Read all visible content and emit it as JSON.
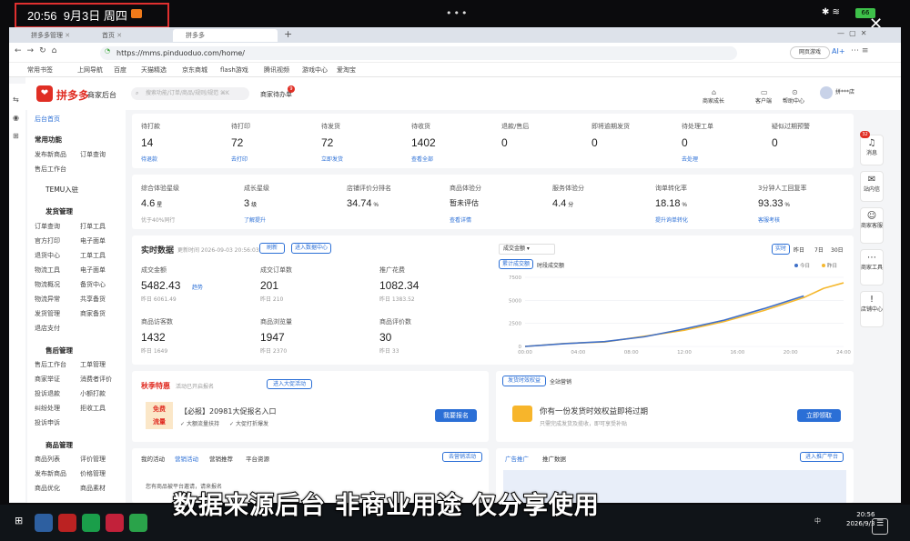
{
  "status": {
    "time": "20:56",
    "date": "9月3日 周四",
    "battery": "66"
  },
  "tabs": [
    {
      "label": "拼多多管理"
    },
    {
      "label": "首页"
    },
    {
      "label": "拼多多"
    }
  ],
  "address": {
    "url": "https://mms.pinduoduo.com/home/",
    "right1": "网页游戏",
    "right2": "AI+"
  },
  "bookmarks": [
    "常用书签",
    "上网导航",
    "百度",
    "天猫精选",
    "京东商城",
    "flash游戏",
    "腾讯视频",
    "游戏中心",
    "爱淘宝"
  ],
  "header": {
    "brand": "拼多多",
    "brand_sub": "商家后台",
    "search_placeholder": "搜索功能/订单/商品/规则/规范 ⌘K",
    "msg": "商家待办单",
    "msg_badge": "9",
    "tools": [
      "商家成长",
      "客户端",
      "帮助中心"
    ],
    "user": "拼***店"
  },
  "nav": {
    "home": "后台首页",
    "sections": [
      {
        "title": "常用功能",
        "items": [
          "发布新商品",
          "订单查询",
          "售后工作台"
        ]
      },
      {
        "title": "TEMU入驻",
        "items": []
      },
      {
        "title": "发货管理",
        "items": [
          "订单查询",
          "打单工具",
          "官方打印",
          "电子面单",
          "退货中心",
          "工单工具",
          "物流工具",
          "电子面单",
          "物流概况",
          "备货中心",
          "物流异常",
          "共享备货",
          "发货管理",
          "商家备货",
          "退店支付"
        ]
      },
      {
        "title": "售后管理",
        "items": [
          "售后工作台",
          "工单管理",
          "商家举证",
          "消费者评价",
          "投诉退款",
          "小额打款",
          "纠纷处理",
          "拒收工具",
          "投诉申诉"
        ]
      },
      {
        "title": "商品管理",
        "items": [
          "商品列表",
          "评价管理",
          "发布新商品",
          "价格管理",
          "商品优化",
          "商品素材"
        ]
      }
    ]
  },
  "todo": [
    {
      "label": "待打款",
      "value": "14",
      "link": "待退款"
    },
    {
      "label": "待打印",
      "value": "72",
      "link": "去打印"
    },
    {
      "label": "待发货",
      "value": "72",
      "link": "立即发货"
    },
    {
      "label": "待收货",
      "value": "1402",
      "link": "查看全部"
    },
    {
      "label": "退款/售后",
      "value": "0",
      "link": ""
    },
    {
      "label": "即将逾期发货",
      "value": "0",
      "link": ""
    },
    {
      "label": "待处理工单",
      "value": "0",
      "link": "去处理"
    },
    {
      "label": "疑似过期预警",
      "value": "0",
      "link": ""
    }
  ],
  "health": [
    {
      "label": "综合体验星级",
      "value": "4.6",
      "unit": "星",
      "sub": "优于40%同行"
    },
    {
      "label": "成长星级",
      "value": "3",
      "unit": "级",
      "sub": "了解提升"
    },
    {
      "label": "店铺评价分排名",
      "value": "34.74",
      "unit": "%",
      "sub": ""
    },
    {
      "label": "商品体验分",
      "value": "暂未评估",
      "unit": "",
      "sub": "查看详情"
    },
    {
      "label": "服务体验分",
      "value": "4.4",
      "unit": "分",
      "sub": ""
    },
    {
      "label": "询单转化率",
      "value": "18.18",
      "unit": "%",
      "sub": "提升询单转化"
    },
    {
      "label": "3分钟人工回复率",
      "value": "93.33",
      "unit": "%",
      "sub": "客服考核"
    }
  ],
  "realtime": {
    "title": "实时数据",
    "updated": "更新时间 2026-09-03 20:56:03",
    "btn_refresh": "刷新",
    "btn_enter": "进入数据中心",
    "metrics": [
      {
        "label": "成交金额",
        "value": "5482.43",
        "sub": "昨日 6061.49",
        "link": "趋势"
      },
      {
        "label": "成交订单数",
        "value": "201",
        "sub": "昨日 210"
      },
      {
        "label": "推广花费",
        "value": "1082.34",
        "sub": "昨日 1383.52"
      },
      {
        "label": "商品访客数",
        "value": "1432",
        "sub": "昨日 1649"
      },
      {
        "label": "商品浏览量",
        "value": "1947",
        "sub": "昨日 2370"
      },
      {
        "label": "商品评价数",
        "value": "30",
        "sub": "昨日 33"
      }
    ]
  },
  "chart_data": {
    "type": "line",
    "title": "",
    "selector": "成交金额",
    "view_tabs": [
      "实时",
      "昨日",
      "7日",
      "30日"
    ],
    "sub_tabs": [
      "累计成交额",
      "时段成交额"
    ],
    "x": [
      "00:00",
      "04:00",
      "08:00",
      "12:00",
      "16:00",
      "20:00",
      "24:00"
    ],
    "yticks": [
      0,
      2500,
      5000,
      7500
    ],
    "ylim": [
      0,
      7500
    ],
    "series": [
      {
        "name": "今日",
        "color": "#3f6fc8",
        "values": [
          0,
          300,
          520,
          1050,
          1900,
          2850,
          4100,
          5480
        ]
      },
      {
        "name": "昨日",
        "color": "#f5b82e",
        "values": [
          0,
          320,
          480,
          1100,
          1750,
          2700,
          3900,
          5300,
          6300,
          6900
        ]
      }
    ],
    "points_x": [
      0,
      3,
      6,
      9,
      12,
      15,
      18,
      21,
      22.5,
      24
    ]
  },
  "promo": {
    "title": "秋季特惠",
    "note": "活动已开启报名",
    "btn": "进入大促活动",
    "badge1": "免费",
    "badge2": "流量",
    "head": "【必报】20981大促报名入口",
    "tips": [
      "大额流量扶持",
      "大促打折爆发"
    ],
    "cta": "我要报名"
  },
  "rights": {
    "tabs": [
      "发货时效权益",
      "全站营销"
    ],
    "title": "你有一份发货时效权益即将过期",
    "sub": "只需完成发货及揽收，即可享受补贴",
    "cta": "立即领取"
  },
  "bottom_left": {
    "tabs": [
      "我的活动",
      "营销活动",
      "营销推荐",
      "平台资源"
    ],
    "btn": "去营销活动",
    "line": "您有商品被平台邀请，请来报名"
  },
  "bottom_right": {
    "tabs": [
      "广告推广",
      "推广数据"
    ],
    "btn": "进入推广平台"
  },
  "rail": [
    "消息",
    "站内信",
    "商家客服",
    "商家工具",
    "店铺中心"
  ],
  "subtitle": "数据来源后台 非商业用途 仅分享使用",
  "taskbar": {
    "time": "20:56",
    "date": "2026/9/3",
    "lang": "中"
  }
}
